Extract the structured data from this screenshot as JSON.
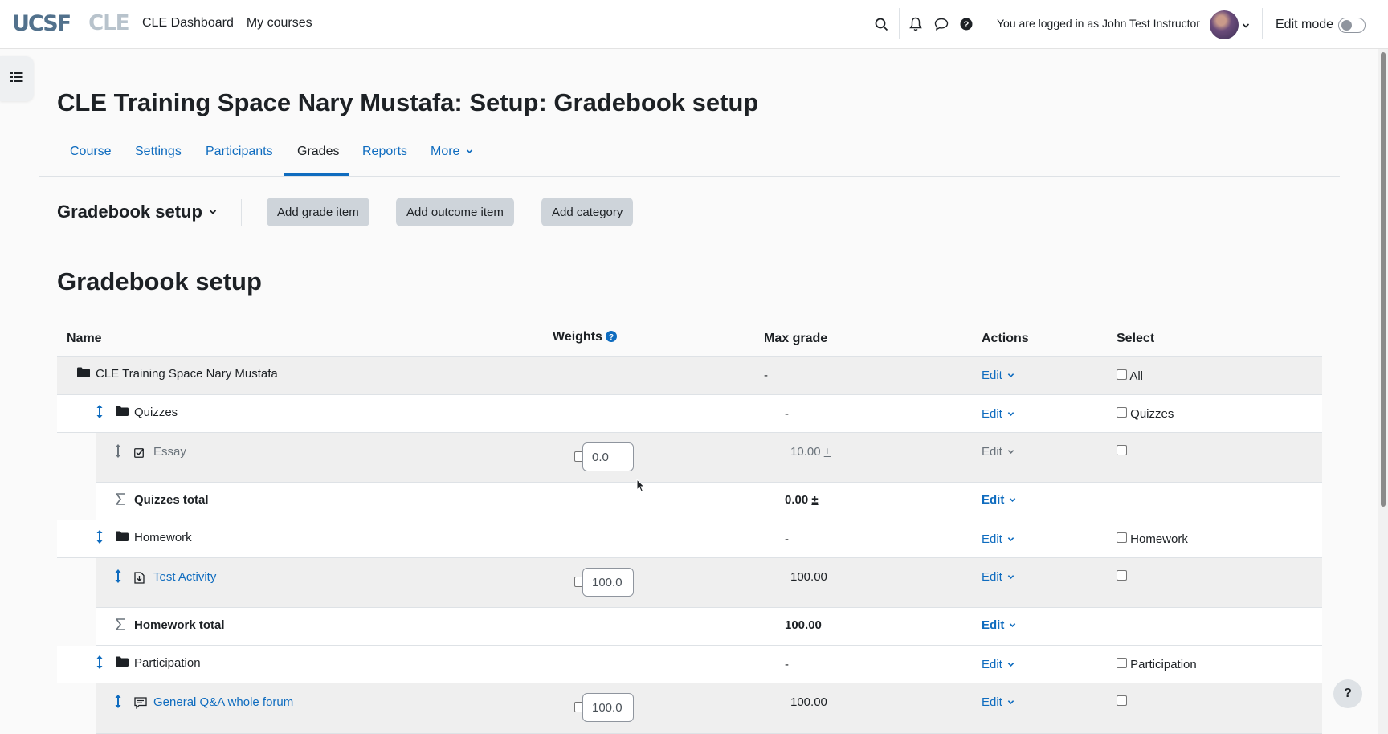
{
  "navbar": {
    "logo_main": "UCSF",
    "logo_sub": "CLE",
    "links": [
      "CLE Dashboard",
      "My courses"
    ],
    "logged_in_text": "You are logged in as John Test Instructor",
    "edit_mode_label": "Edit mode"
  },
  "page": {
    "title": "CLE Training Space Nary Mustafa: Setup: Gradebook setup",
    "tabs": [
      "Course",
      "Settings",
      "Participants",
      "Grades",
      "Reports",
      "More"
    ],
    "active_tab": "Grades"
  },
  "tertiary": {
    "selector_label": "Gradebook setup",
    "buttons": [
      "Add grade item",
      "Add outcome item",
      "Add category"
    ]
  },
  "section_heading": "Gradebook setup",
  "table": {
    "headers": {
      "name": "Name",
      "weights": "Weights",
      "max_grade": "Max grade",
      "actions": "Actions",
      "select": "Select"
    },
    "rows": [
      {
        "type": "top",
        "name": "CLE Training Space Nary Mustafa",
        "max": "-",
        "action": "Edit",
        "select_label": "All"
      },
      {
        "type": "category",
        "name": "Quizzes",
        "max": "-",
        "action": "Edit",
        "select_label": "Quizzes"
      },
      {
        "type": "item",
        "name": "Essay",
        "weight": "0.0",
        "max": "10.00",
        "max_suffix": "±",
        "action": "Edit",
        "hidden": true
      },
      {
        "type": "total",
        "name": "Quizzes total",
        "max": "0.00",
        "max_suffix": "±",
        "action": "Edit"
      },
      {
        "type": "category",
        "name": "Homework",
        "max": "-",
        "action": "Edit",
        "select_label": "Homework"
      },
      {
        "type": "item",
        "name": "Test Activity",
        "weight": "100.0",
        "max": "100.00",
        "action": "Edit"
      },
      {
        "type": "total",
        "name": "Homework total",
        "max": "100.00",
        "action": "Edit"
      },
      {
        "type": "category",
        "name": "Participation",
        "max": "-",
        "action": "Edit",
        "select_label": "Participation"
      },
      {
        "type": "item",
        "name": "General Q&A whole forum",
        "weight": "100.0",
        "max": "100.00",
        "action": "Edit"
      }
    ]
  },
  "help_button": "?",
  "colors": {
    "link": "#0f6cbf",
    "text": "#1d2125",
    "button_bg": "#ced4da",
    "row_shade": "#efefef"
  }
}
